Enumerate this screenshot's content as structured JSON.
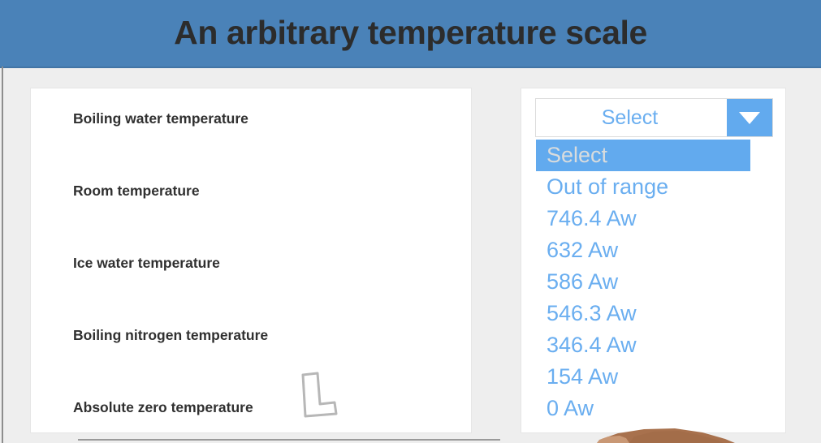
{
  "header": {
    "title": "An arbitrary temperature scale",
    "background_color": "#4a82b8",
    "title_color": "#2c2c2c"
  },
  "left_panel": {
    "name": "temperature-reference-points",
    "items": [
      {
        "label": "Boiling water temperature"
      },
      {
        "label": "Room temperature"
      },
      {
        "label": "Ice water temperature"
      },
      {
        "label": "Boiling nitrogen temperature"
      },
      {
        "label": "Absolute zero temperature"
      }
    ]
  },
  "right_panel": {
    "select": {
      "name": "temperature-value-select",
      "selected_value": "Select",
      "expanded": true,
      "arrow_icon": "chevron-down-icon",
      "accent_color": "#62aaee",
      "text_color": "#6aaef0",
      "highlight_text_color": "#d9dcdd",
      "options": [
        {
          "label": "Select",
          "selected": true
        },
        {
          "label": "Out of range",
          "selected": false
        },
        {
          "label": "746.4 Aw",
          "selected": false
        },
        {
          "label": "632 Aw",
          "selected": false
        },
        {
          "label": "586 Aw",
          "selected": false
        },
        {
          "label": "546.3 Aw",
          "selected": false
        },
        {
          "label": "346.4 Aw",
          "selected": false
        },
        {
          "label": "154 Aw",
          "selected": false
        },
        {
          "label": "0 Aw",
          "selected": false
        }
      ]
    }
  },
  "overlays": {
    "ghost_cursor": {
      "name": "ghost-cursor-icon",
      "color": "#b0b0b0"
    },
    "hand": {
      "name": "hand-illustration",
      "color": "#a87050"
    }
  },
  "page": {
    "background_color": "#eeeeee",
    "card_background_color": "#ffffff"
  }
}
